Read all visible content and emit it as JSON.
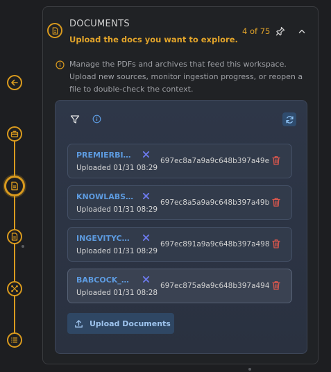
{
  "panel": {
    "title": "DOCUMENTS",
    "subtitle": "Upload the docs you want to explore.",
    "count": "4 of 75",
    "description": "Manage the PDFs and archives that feed this workspace. Upload new sources, monitor ingestion progress, or reopen a file to double-check the context."
  },
  "files": [
    {
      "name": "PREMIERBIOMEDICAL",
      "uploaded": "Uploaded 01/31 08:29",
      "id": "697ec8a7a9a9c648b397a49e"
    },
    {
      "name": "KNOWLABS,INC",
      "uploaded": "Uploaded 01/31 08:29",
      "id": "697ec8a5a9a9c648b397a49b"
    },
    {
      "name": "INGEVITYCORP",
      "uploaded": "Uploaded 01/31 08:29",
      "id": "697ec891a9a9c648b397a498"
    },
    {
      "name": "BABCOCK_WILCOX",
      "uploaded": "Uploaded 01/31 08:28",
      "id": "697ec875a9a9c648b397a494"
    }
  ],
  "upload_label": "Upload Documents",
  "colors": {
    "accent": "#d99a1e",
    "link": "#5d9be0",
    "danger": "#d9574d"
  }
}
